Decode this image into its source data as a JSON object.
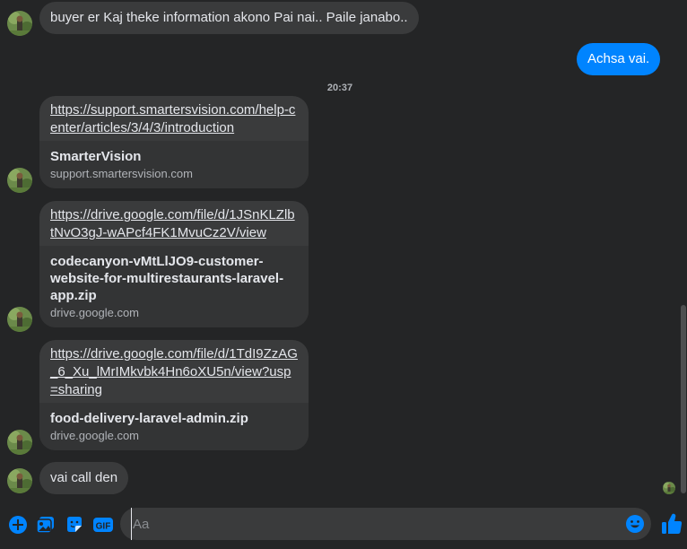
{
  "conversation": {
    "messages": [
      {
        "direction": "incoming",
        "text": "buyer er Kaj theke information akono Pai nai.. Paile janabo.."
      },
      {
        "direction": "outgoing",
        "text": "Achsa vai."
      }
    ],
    "timestamp": "20:37",
    "links": [
      {
        "url": "https://support.smartersvision.com/help-center/articles/3/4/3/introduction",
        "title": "SmarterVision",
        "domain": "support.smartersvision.com"
      },
      {
        "url": "https://drive.google.com/file/d/1JSnKLZlbtNvO3gJ-wAPcf4FK1MvuCz2V/view",
        "title": "codecanyon-vMtLlJO9-customer-website-for-multirestaurants-laravel-app.zip",
        "domain": "drive.google.com"
      },
      {
        "url": "https://drive.google.com/file/d/1TdI9ZzAG_6_Xu_lMrIMkvbk4Hn6oXU5n/view?usp=sharing",
        "title": "food-delivery-laravel-admin.zip",
        "domain": "drive.google.com"
      }
    ],
    "last_message": "vai call den"
  },
  "composer": {
    "placeholder": "Aa",
    "icons": [
      "plus-circle-icon",
      "photo-icon",
      "sticker-icon",
      "gif-icon",
      "emoji-icon",
      "thumbs-up-icon"
    ]
  },
  "colors": {
    "background": "#242526",
    "incoming_bubble": "#3a3b3c",
    "outgoing_bubble": "#0084ff",
    "accent": "#0084ff"
  }
}
